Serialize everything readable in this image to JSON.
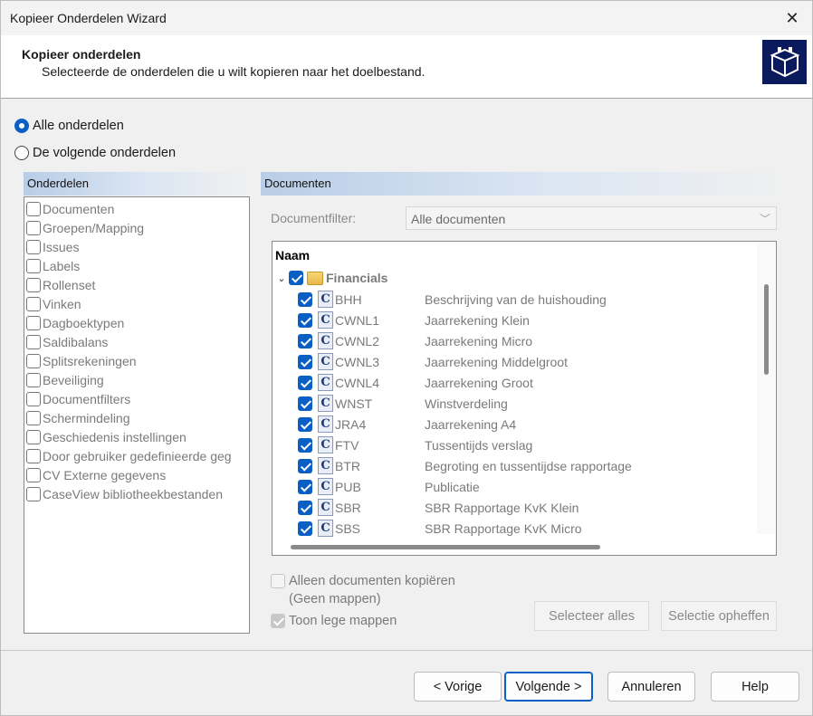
{
  "window": {
    "title": "Kopieer Onderdelen Wizard"
  },
  "header": {
    "title": "Kopieer onderdelen",
    "subtitle": "Selecteerde de onderdelen die u wilt kopieren naar het doelbestand."
  },
  "scope": {
    "all_label": "Alle onderdelen",
    "some_label": "De volgende onderdelen",
    "selected": "all"
  },
  "parts_panel": {
    "header": "Onderdelen",
    "items": [
      "Documenten",
      "Groepen/Mapping",
      "Issues",
      "Labels",
      "Rollenset",
      "Vinken",
      "Dagboektypen",
      "Saldibalans",
      "Splitsrekeningen",
      "Beveiliging",
      "Documentfilters",
      "Schermindeling",
      "Geschiedenis instellingen",
      "Door gebruiker gedefinieerde geg",
      "CV Externe gegevens",
      "CaseView bibliotheekbestanden"
    ]
  },
  "documents_panel": {
    "header": "Documenten",
    "filter_label": "Documentfilter:",
    "filter_value": "Alle documenten",
    "column_name": "Naam",
    "folder": {
      "name": "Financials",
      "expanded": true,
      "checked": true
    },
    "documents": [
      {
        "code": "BHH",
        "description": "Beschrijving van de huishouding"
      },
      {
        "code": "CWNL1",
        "description": "Jaarrekening Klein"
      },
      {
        "code": "CWNL2",
        "description": "Jaarrekening Micro"
      },
      {
        "code": "CWNL3",
        "description": "Jaarrekening Middelgroot"
      },
      {
        "code": "CWNL4",
        "description": "Jaarrekening Groot"
      },
      {
        "code": "WNST",
        "description": "Winstverdeling"
      },
      {
        "code": "JRA4",
        "description": "Jaarrekening A4"
      },
      {
        "code": "FTV",
        "description": "Tussentijds verslag"
      },
      {
        "code": "BTR",
        "description": "Begroting en tussentijdse rapportage"
      },
      {
        "code": "PUB",
        "description": "Publicatie"
      },
      {
        "code": "SBR",
        "description": "SBR Rapportage KvK Klein"
      },
      {
        "code": "SBS",
        "description": "SBR Rapportage KvK Micro"
      }
    ],
    "doc_icon_letter": "C",
    "only_docs_label_line1": "Alleen documenten kopiëren",
    "only_docs_label_line2": "(Geen mappen)",
    "show_empty_label": "Toon lege mappen",
    "select_all": "Selecteer alles",
    "clear_selection": "Selectie opheffen"
  },
  "footer": {
    "back": "< Vorige",
    "next": "Volgende >",
    "cancel": "Annuleren",
    "help": "Help"
  },
  "icons": {
    "close": "close-icon",
    "logo": "cube-logo-icon",
    "expander": "chevron-down-icon",
    "folder": "folder-icon",
    "document": "caseview-document-icon"
  },
  "colors": {
    "accent": "#0a5fc4",
    "logo_bg": "#0b1a5c"
  }
}
